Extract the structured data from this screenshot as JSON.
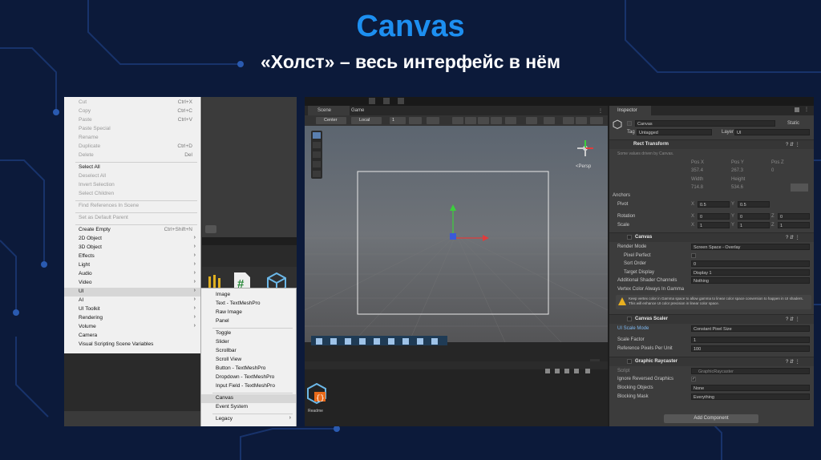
{
  "title": "Canvas",
  "subtitle": "«Холст» – весь интерфейс в нём",
  "colors": {
    "title": "#1d8ff0",
    "background": "#0c1a3a"
  },
  "context_menu": {
    "items": [
      {
        "label": "Cut",
        "shortcut": "Ctrl+X",
        "disabled": true
      },
      {
        "label": "Copy",
        "shortcut": "Ctrl+C",
        "disabled": true
      },
      {
        "label": "Paste",
        "shortcut": "Ctrl+V",
        "disabled": true
      },
      {
        "label": "Paste Special",
        "disabled": true
      },
      {
        "label": "Rename",
        "disabled": true
      },
      {
        "label": "Duplicate",
        "shortcut": "Ctrl+D",
        "disabled": true
      },
      {
        "label": "Delete",
        "shortcut": "Del",
        "disabled": true
      },
      {
        "label": "Select All",
        "disabled": false
      },
      {
        "label": "Deselect All",
        "disabled": true
      },
      {
        "label": "Invert Selection",
        "disabled": true
      },
      {
        "label": "Select Children",
        "disabled": true
      },
      {
        "label": "Find References In Scene",
        "disabled": true
      },
      {
        "label": "Set as Default Parent",
        "disabled": true
      },
      {
        "label": "Create Empty",
        "shortcut": "Ctrl+Shift+N",
        "disabled": false
      },
      {
        "label": "2D Object",
        "disabled": false
      },
      {
        "label": "3D Object",
        "disabled": false
      },
      {
        "label": "Effects",
        "disabled": false
      },
      {
        "label": "Light",
        "disabled": false
      },
      {
        "label": "Audio",
        "disabled": false
      },
      {
        "label": "Video",
        "disabled": false
      },
      {
        "label": "UI",
        "disabled": false
      },
      {
        "label": "AI",
        "disabled": false
      },
      {
        "label": "UI Toolkit",
        "disabled": false
      },
      {
        "label": "Rendering",
        "disabled": false
      },
      {
        "label": "Volume",
        "disabled": false
      },
      {
        "label": "Camera",
        "disabled": false
      },
      {
        "label": "Visual Scripting Scene Variables",
        "disabled": false
      }
    ],
    "submenu_ui": [
      "Image",
      "Text - TextMeshPro",
      "Raw Image",
      "Panel",
      "Toggle",
      "Slider",
      "Scrollbar",
      "Scroll View",
      "Button - TextMeshPro",
      "Dropdown - TextMeshPro",
      "Input Field - TextMeshPro",
      "Canvas",
      "Event System",
      "Legacy"
    ]
  },
  "scene_view": {
    "tabs": [
      "Scene",
      "Game"
    ],
    "toolbar": {
      "pivot": "Center",
      "space": "Local",
      "grid_size": "1"
    },
    "persp_label": "<Persp",
    "readme_label": "Readme"
  },
  "inspector": {
    "tab": "Inspector",
    "object_name": "Canvas",
    "static_label": "Static",
    "tag_label": "Tag",
    "tag_value": "Untagged",
    "layer_label": "Layer",
    "layer_value": "UI",
    "rect_transform": {
      "title": "Rect Transform",
      "note": "Some values driven by Canvas.",
      "pos_labels": [
        "Pos X",
        "Pos Y",
        "Pos Z"
      ],
      "pos_values": [
        "357.4",
        "267.3",
        "0"
      ],
      "size_labels": [
        "Width",
        "Height"
      ],
      "size_values": [
        "714.8",
        "534.6"
      ],
      "anchors": "Anchors",
      "pivot": "Pivot",
      "pivot_x": "0.5",
      "pivot_y": "0.5",
      "rotation": "Rotation",
      "rot_x": "0",
      "rot_y": "0",
      "rot_z": "0",
      "scale": "Scale",
      "scale_x": "1",
      "scale_y": "1",
      "scale_z": "1"
    },
    "canvas": {
      "title": "Canvas",
      "render_mode_label": "Render Mode",
      "render_mode": "Screen Space - Overlay",
      "pixel_perfect": "Pixel Perfect",
      "sort_order_label": "Sort Order",
      "sort_order": "0",
      "target_display_label": "Target Display",
      "target_display": "Display 1",
      "shader_channels_label": "Additional Shader Channels",
      "shader_channels": "Nothing",
      "vertex_color": "Vertex Color Always In Gamma",
      "warning": "Keep vertex color in Gamma space to allow gamma to linear color space conversion to happen in UI shaders. This will enhance UI color precision in linear color space."
    },
    "canvas_scaler": {
      "title": "Canvas Scaler",
      "scale_mode_label": "UI Scale Mode",
      "scale_mode": "Constant Pixel Size",
      "scale_factor_label": "Scale Factor",
      "scale_factor": "1",
      "ref_ppu_label": "Reference Pixels Per Unit",
      "ref_ppu": "100"
    },
    "raycaster": {
      "title": "Graphic Raycaster",
      "script_label": "Script",
      "script_value": "GraphicRaycaster",
      "ignore_reversed": "Ignore Reversed Graphics",
      "blocking_objects_label": "Blocking Objects",
      "blocking_objects": "None",
      "blocking_mask_label": "Blocking Mask",
      "blocking_mask": "Everything"
    },
    "add_component": "Add Component"
  }
}
